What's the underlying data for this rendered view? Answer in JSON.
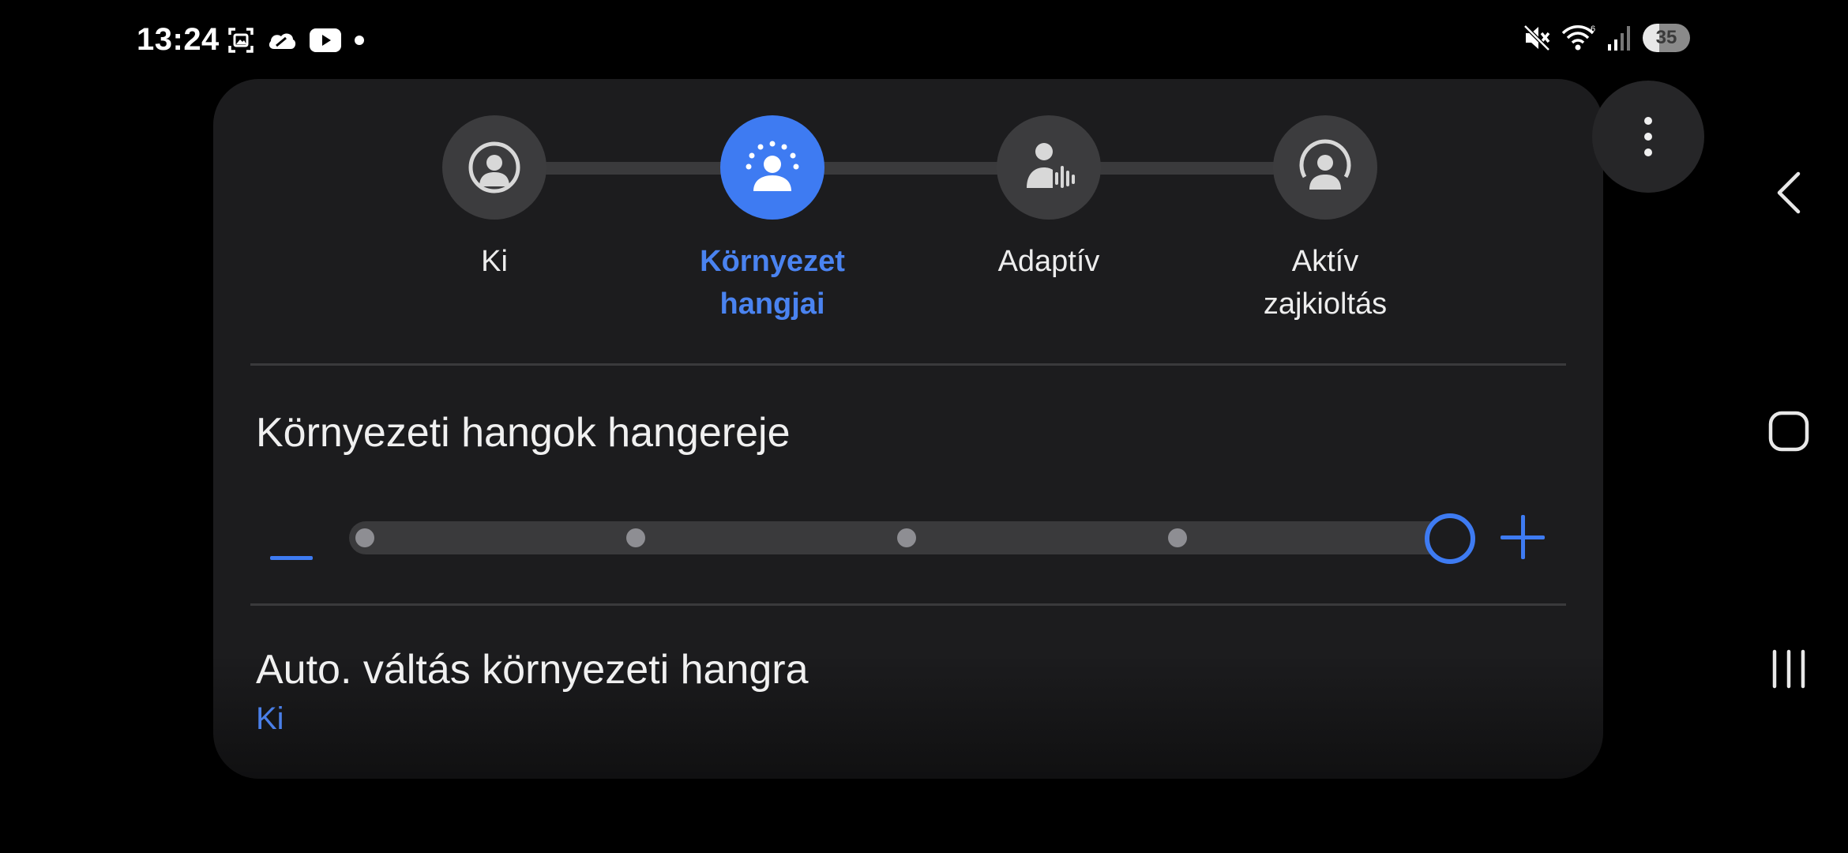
{
  "status_bar": {
    "time": "13:24",
    "left_icons": [
      "screenshot-icon",
      "cloud-icon",
      "youtube-icon",
      "notification-dot-icon"
    ],
    "right_icons": [
      "mute-icon",
      "wifi-icon",
      "signal-icon"
    ],
    "battery": "35"
  },
  "modes": [
    {
      "label": "Ki",
      "icon": "person-icon",
      "active": false
    },
    {
      "label": "Környezet hangjai",
      "icon": "ambient-person-icon",
      "active": true
    },
    {
      "label": "Adaptív",
      "icon": "adaptive-person-icon",
      "active": false
    },
    {
      "label": "Aktív zajkioltás",
      "icon": "anc-person-icon",
      "active": false
    }
  ],
  "ambient_volume": {
    "title": "Környezeti hangok hangereje",
    "level": 5,
    "max": 5
  },
  "auto_switch": {
    "title": "Auto. váltás környezeti hangra",
    "value": "Ki"
  },
  "colors": {
    "accent": "#3e7bf2",
    "panel": "#1c1c1e",
    "background": "#000000"
  },
  "navigation": [
    "back-icon",
    "home-icon",
    "recents-icon"
  ]
}
